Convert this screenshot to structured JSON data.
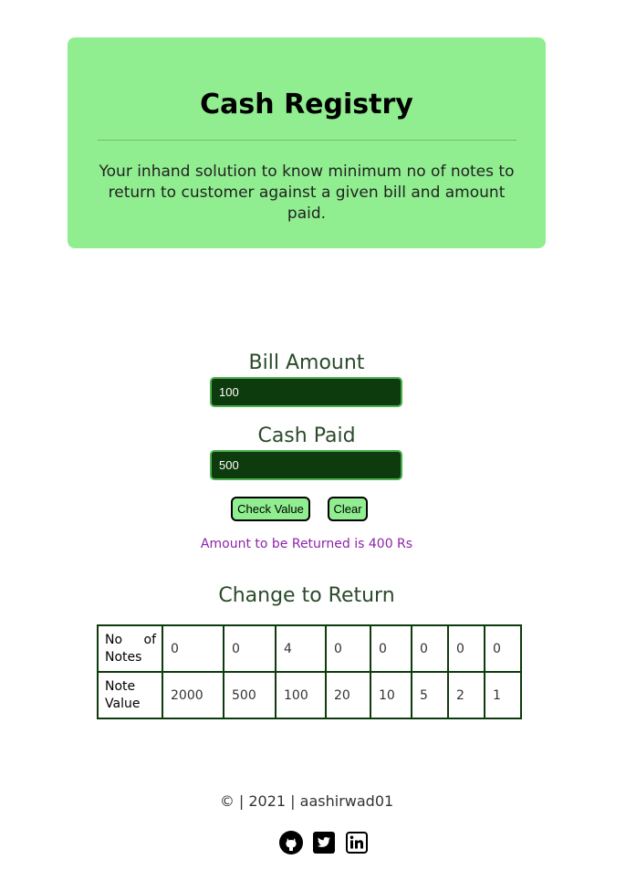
{
  "header": {
    "title": "Cash Registry",
    "description": "Your inhand solution to know minimum no of notes to return to customer against a given bill and amount paid."
  },
  "form": {
    "bill_label": "Bill Amount",
    "bill_value": "100",
    "cash_label": "Cash Paid",
    "cash_value": "500",
    "check_button": "Check Value",
    "clear_button": "Clear"
  },
  "result_message": "Amount to be Returned is 400 Rs",
  "change": {
    "title": "Change to Return",
    "row_headers": [
      "No of Notes",
      "Note Value"
    ],
    "counts": [
      "0",
      "0",
      "4",
      "0",
      "0",
      "0",
      "0",
      "0"
    ],
    "values": [
      "2000",
      "500",
      "100",
      "20",
      "10",
      "5",
      "2",
      "1"
    ]
  },
  "footer": {
    "text": "© | 2021 | aashirwad01",
    "icons": [
      "github-icon",
      "twitter-icon",
      "linkedin-icon"
    ]
  },
  "colors": {
    "accent": "#90ee90",
    "input_bg": "#0d3b0d",
    "result_text": "#8e24aa"
  }
}
